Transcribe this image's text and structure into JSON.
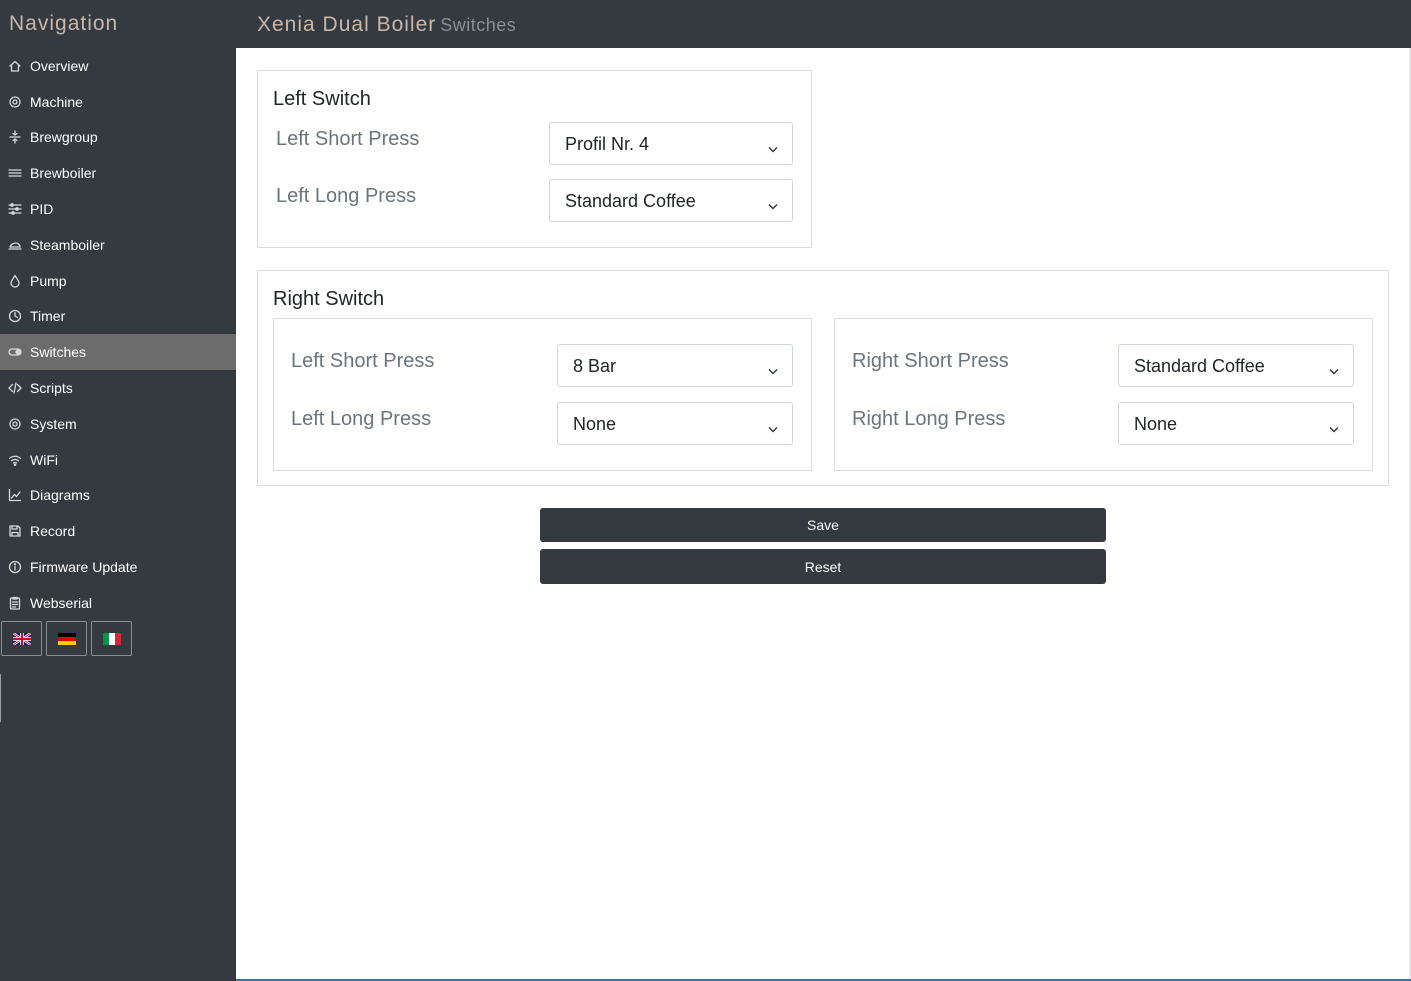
{
  "sidebar": {
    "title": "Navigation",
    "items": [
      {
        "label": "Overview",
        "icon": "home-icon"
      },
      {
        "label": "Machine",
        "icon": "gear-icon"
      },
      {
        "label": "Brewgroup",
        "icon": "brewgroup-icon"
      },
      {
        "label": "Brewboiler",
        "icon": "waves-icon"
      },
      {
        "label": "PID",
        "icon": "sliders-icon"
      },
      {
        "label": "Steamboiler",
        "icon": "steam-icon"
      },
      {
        "label": "Pump",
        "icon": "drop-icon"
      },
      {
        "label": "Timer",
        "icon": "clock-icon"
      },
      {
        "label": "Switches",
        "icon": "toggle-icon",
        "active": true
      },
      {
        "label": "Scripts",
        "icon": "code-icon"
      },
      {
        "label": "System",
        "icon": "gear-icon"
      },
      {
        "label": "WiFi",
        "icon": "wifi-icon"
      },
      {
        "label": "Diagrams",
        "icon": "chart-icon"
      },
      {
        "label": "Record",
        "icon": "save-icon"
      },
      {
        "label": "Firmware Update",
        "icon": "info-icon"
      },
      {
        "label": "Webserial",
        "icon": "clipboard-icon"
      }
    ],
    "languages": [
      "en-flag-icon",
      "de-flag-icon",
      "it-flag-icon"
    ]
  },
  "header": {
    "title": "Xenia Dual Boiler",
    "subtitle": "Switches"
  },
  "left_switch": {
    "title": "Left Switch",
    "short_label": "Left Short Press",
    "short_value": "Profil Nr. 4",
    "long_label": "Left Long Press",
    "long_value": "Standard Coffee"
  },
  "right_switch": {
    "title": "Right Switch",
    "left_short_label": "Left Short Press",
    "left_short_value": "8 Bar",
    "left_long_label": "Left Long Press",
    "left_long_value": "None",
    "right_short_label": "Right Short Press",
    "right_short_value": "Standard Coffee",
    "right_long_label": "Right Long Press",
    "right_long_value": "None"
  },
  "actions": {
    "save_label": "Save",
    "reset_label": "Reset"
  },
  "colors": {
    "sidebar_bg": "#343a40",
    "active_item_bg": "#6c6c6c",
    "title_accent": "#c8b7a8",
    "button_bg": "#343a40"
  }
}
